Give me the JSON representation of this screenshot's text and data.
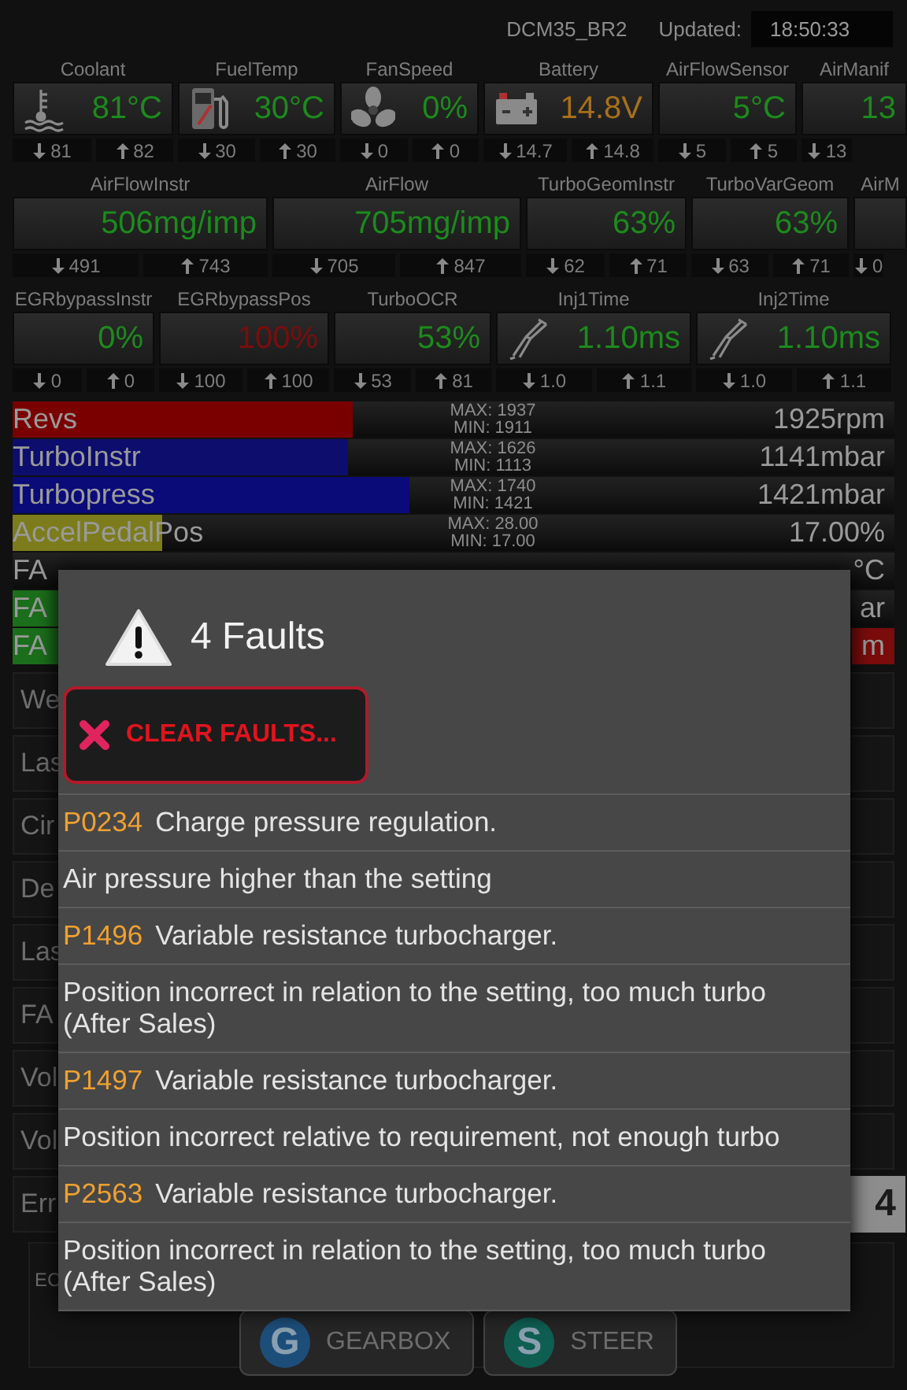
{
  "header": {
    "device": "DCM35_BR2",
    "updated_label": "Updated:",
    "time": "18:50:33"
  },
  "gauge_rows": [
    {
      "tiles": [
        {
          "label": "Coolant",
          "value": "81°C",
          "color": "#1d8a1d",
          "min": "81",
          "max": "82"
        },
        {
          "label": "FuelTemp",
          "value": "30°C",
          "color": "#1d8a1d",
          "min": "30",
          "max": "30"
        },
        {
          "label": "FanSpeed",
          "value": "0%",
          "color": "#1d8a1d",
          "min": "0",
          "max": "0"
        },
        {
          "label": "Battery",
          "value": "14.8V",
          "color": "#a8701a",
          "min": "14.7",
          "max": "14.8"
        },
        {
          "label": "AirFlowSensor",
          "value": "5°C",
          "color": "#1d8a1d",
          "min": "5",
          "max": "5"
        },
        {
          "label": "AirManif",
          "value": "13",
          "color": "#1d8a1d",
          "min": "13"
        }
      ]
    },
    {
      "tiles": [
        {
          "label": "AirFlowInstr",
          "value": "506mg/imp",
          "color": "#1d8a1d",
          "min": "491",
          "max": "743"
        },
        {
          "label": "AirFlow",
          "value": "705mg/imp",
          "color": "#1d8a1d",
          "min": "705",
          "max": "847"
        },
        {
          "label": "TurboGeomInstr",
          "value": "63%",
          "color": "#1d8a1d",
          "min": "62",
          "max": "71"
        },
        {
          "label": "TurboVarGeom",
          "value": "63%",
          "color": "#1d8a1d",
          "min": "63",
          "max": "71"
        },
        {
          "label": "AirM",
          "min": "0"
        }
      ]
    },
    {
      "tiles": [
        {
          "label": "EGRbypassInstr",
          "value": "0%",
          "color": "#1d8a1d",
          "min": "0",
          "max": "0"
        },
        {
          "label": "EGRbypassPos",
          "value": "100%",
          "color": "#7a0d0d",
          "min": "100",
          "max": "100"
        },
        {
          "label": "TurboOCR",
          "value": "53%",
          "color": "#1d8a1d",
          "min": "53",
          "max": "81"
        },
        {
          "label": "Inj1Time",
          "value": "1.10ms",
          "color": "#1d8a1d",
          "min": "1.0",
          "max": "1.1"
        },
        {
          "label": "Inj2Time",
          "value": "1.10ms",
          "color": "#1d8a1d",
          "min": "1.0",
          "max": "1.1"
        }
      ]
    }
  ],
  "meters": [
    {
      "label": "Revs",
      "max": "MAX: 1937",
      "min": "MIN: 1911",
      "reading": "1925rpm",
      "level": 0.386,
      "color": "#7a0000",
      "alarm": false
    },
    {
      "label": "TurboInstr",
      "max": "MAX: 1626",
      "min": "MIN: 1113",
      "reading": "1141mbar",
      "level": 0.38,
      "color": "#0d0d6e",
      "alarm": false
    },
    {
      "label": "Turbopress",
      "max": "MAX: 1740",
      "min": "MIN: 1421",
      "reading": "1421mbar",
      "level": 0.45,
      "color": "#0a0a78",
      "alarm": false
    },
    {
      "label": "AccelPedalPos",
      "max": "MAX: 28.00",
      "min": "MIN: 17.00",
      "reading": "17.00%",
      "level": 0.17,
      "color": "#7c7c1c",
      "alarm": false
    },
    {
      "label": "FA",
      "reading": "°C",
      "alarm": false
    },
    {
      "label": "FA",
      "reading": "ar",
      "level": 0.06,
      "color": "#1b6e1b",
      "alarm": false
    },
    {
      "label": "FA",
      "reading": "m",
      "level": 0.06,
      "color": "#1b6e1b",
      "alarm": true
    }
  ],
  "info_rows": [
    {
      "label": "We"
    },
    {
      "label": "Las"
    },
    {
      "label": "Cir"
    },
    {
      "label": "De"
    },
    {
      "label": "Las"
    },
    {
      "label": "FA"
    },
    {
      "label": "Vol"
    },
    {
      "label": "Vol"
    },
    {
      "label": "Err",
      "value": "4"
    }
  ],
  "panel": {
    "label": "EC",
    "buttons": [
      {
        "letter": "G",
        "label": "GEARBOX",
        "color": "#1d4e7a"
      },
      {
        "letter": "S",
        "label": "STEER",
        "color": "#0f5e52"
      }
    ]
  },
  "dialog": {
    "title": "4 Faults",
    "clear_button": "CLEAR FAULTS...",
    "faults": [
      {
        "code": "P0234",
        "title": "Charge pressure regulation.",
        "description": "Air pressure higher than the setting"
      },
      {
        "code": "P1496",
        "title": "Variable resistance turbocharger.",
        "description": "Position incorrect in relation to the setting, too much turbo (After Sales)"
      },
      {
        "code": "P1497",
        "title": "Variable resistance turbocharger.",
        "description": "Position incorrect relative to requirement, not enough turbo"
      },
      {
        "code": "P2563",
        "title": "Variable resistance turbocharger.",
        "description": "Position incorrect in relation to the setting, too much turbo (After Sales)"
      }
    ]
  }
}
